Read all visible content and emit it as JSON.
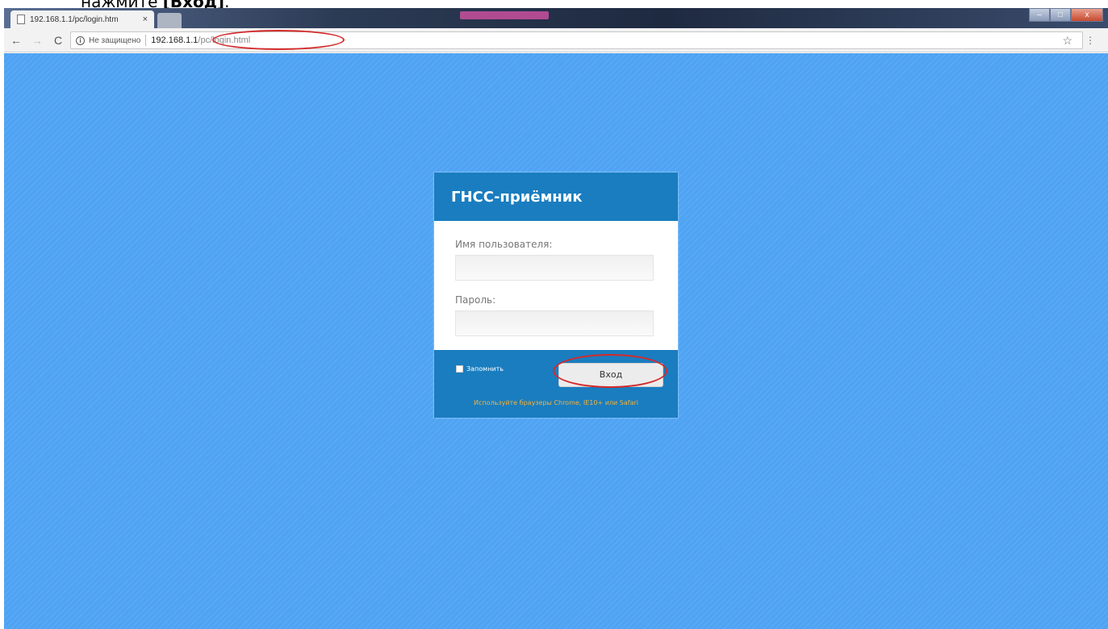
{
  "caption": {
    "prefix": "нажмите ",
    "bold": "[Вход]",
    "suffix": "."
  },
  "browser": {
    "tab_title": "192.168.1.1/pc/login.htm",
    "tab_close": "×",
    "address": {
      "security_label": "Не защищено",
      "host": "192.168.1.1",
      "path": "/pc/login.html"
    },
    "icons": {
      "back": "←",
      "forward": "→",
      "reload": "C",
      "info": "i",
      "star": "☆",
      "menu": "⋮"
    },
    "window_controls": {
      "minimize": "–",
      "maximize": "□",
      "close": "x"
    }
  },
  "login": {
    "title": "ГНСС-приёмник",
    "username_label": "Имя пользователя:",
    "username_value": "",
    "password_label": "Пароль:",
    "password_value": "",
    "remember_label": "Запомнить",
    "submit_label": "Вход",
    "browser_note": "Используйте браузеры Chrome, IE10+ или Safari"
  },
  "colors": {
    "page_background": "#4fa3f3",
    "card_header": "#1a7dbf",
    "annotation": "#d42a2a",
    "note_text": "#f2b33d"
  }
}
